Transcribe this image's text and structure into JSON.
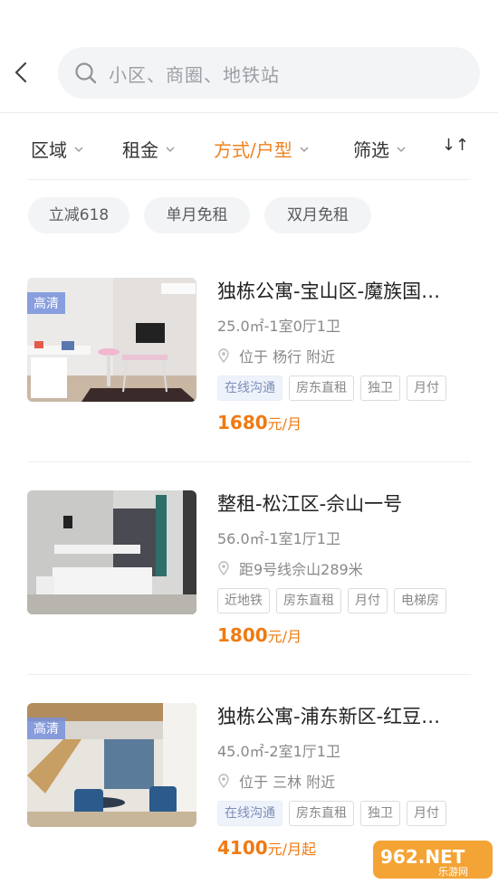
{
  "search": {
    "placeholder": "小区、商圈、地铁站"
  },
  "filters": [
    {
      "label": "区域",
      "active": false
    },
    {
      "label": "租金",
      "active": false
    },
    {
      "label": "方式/户型",
      "active": true
    },
    {
      "label": "筛选",
      "active": false
    }
  ],
  "sort_icon": "↓↑",
  "promo_tags": [
    "立减618",
    "单月免租",
    "双月免租"
  ],
  "listings": [
    {
      "badge": "高清",
      "title": "独栋公寓-宝山区-魔族国…",
      "meta": "25.0㎡-1室0厅1卫",
      "location": "位于 杨行 附近",
      "tags": [
        "在线沟通",
        "房东直租",
        "独卫",
        "月付"
      ],
      "price": "1680",
      "price_unit": "元/月"
    },
    {
      "badge": "",
      "title": "整租-松江区-佘山一号",
      "meta": "56.0㎡-1室1厅1卫",
      "location": "距9号线佘山289米",
      "tags": [
        "近地铁",
        "房东直租",
        "月付",
        "电梯房"
      ],
      "price": "1800",
      "price_unit": "元/月"
    },
    {
      "badge": "高清",
      "title": "独栋公寓-浦东新区-红豆…",
      "meta": "45.0㎡-2室1厅1卫",
      "location": "位于 三林 附近",
      "tags": [
        "在线沟通",
        "房东直租",
        "独卫",
        "月付"
      ],
      "price": "4100",
      "price_unit": "元/月起"
    }
  ],
  "watermark": {
    "brand": "962.NET",
    "sub": "乐游网"
  },
  "colors": {
    "accent": "#f0821e",
    "price": "#f07a12",
    "tag_bg": "#f3f4f6"
  }
}
